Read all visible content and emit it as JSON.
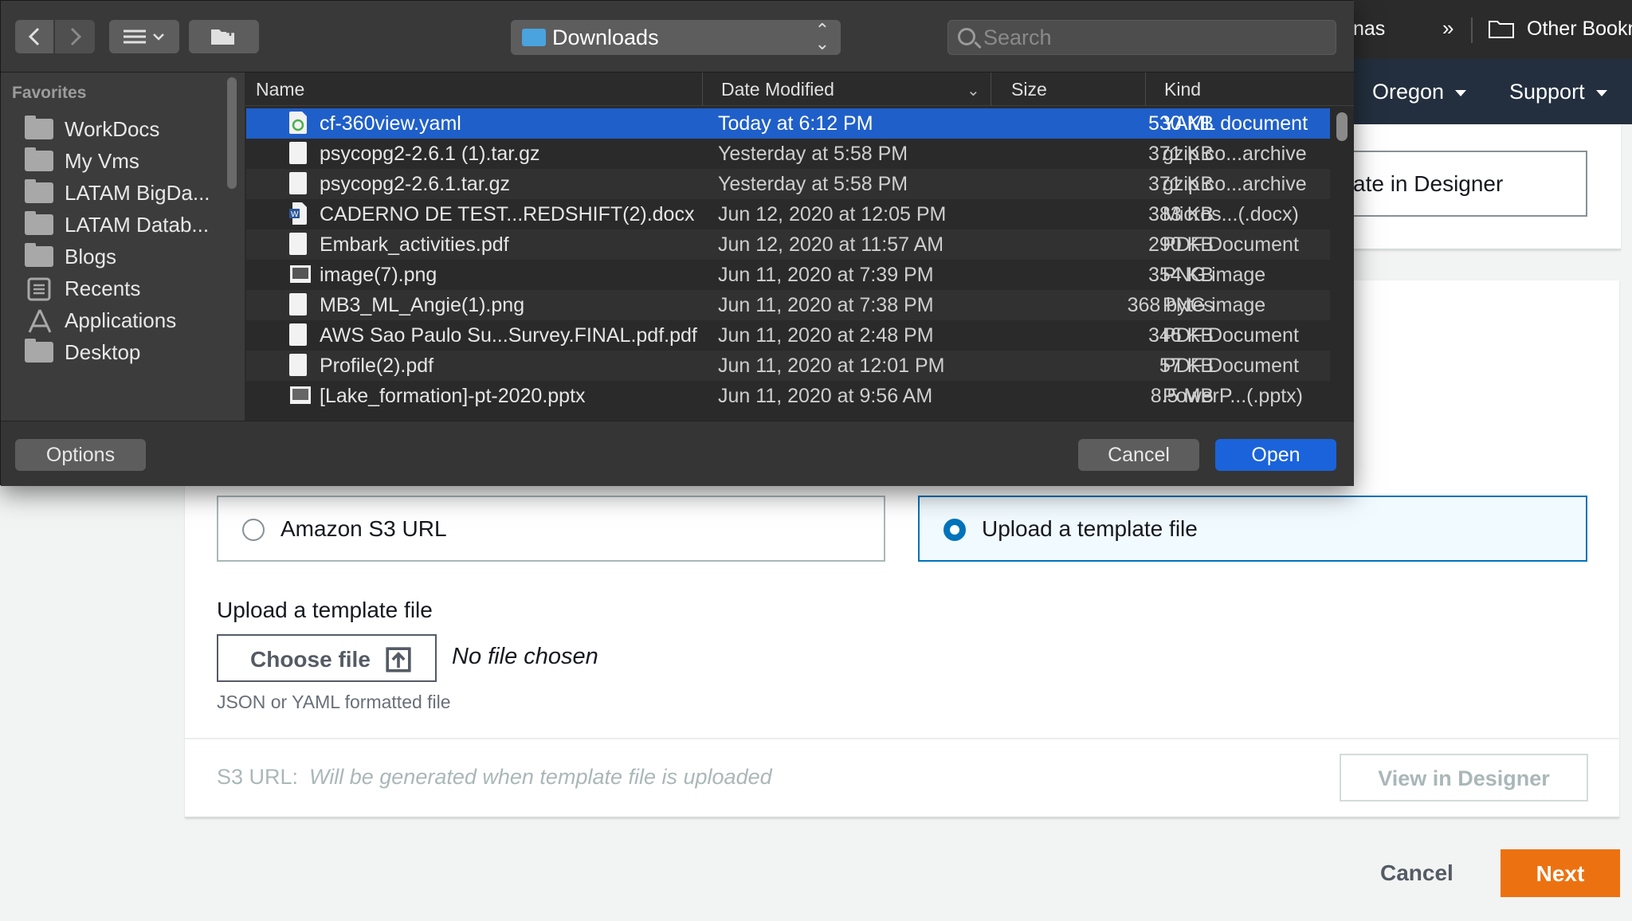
{
  "browser": {
    "bookmark_fragment": "nas",
    "bookmark_overflow": "»",
    "other_bookmarks": "Other Bookmarks"
  },
  "aws_nav": {
    "region": "Oregon",
    "support": "Support"
  },
  "top_card": {
    "designer_button_fragment": "ate in Designer"
  },
  "template_source": {
    "options": [
      {
        "label": "Amazon S3 URL",
        "selected": false
      },
      {
        "label": "Upload a template file",
        "selected": true
      }
    ],
    "upload_heading": "Upload a template file",
    "choose_file_label": "Choose file",
    "no_file_text": "No file chosen",
    "hint": "JSON or YAML formatted file",
    "s3_url_label": "S3 URL:",
    "s3_url_value": "Will be generated when template file is uploaded",
    "view_in_designer": "View in Designer"
  },
  "page_actions": {
    "cancel": "Cancel",
    "next": "Next"
  },
  "dialog": {
    "location": "Downloads",
    "search_placeholder": "Search",
    "sidebar": {
      "heading": "Favorites",
      "items": [
        {
          "label": "WorkDocs",
          "icon": "folder-icon"
        },
        {
          "label": "My Vms",
          "icon": "folder-icon"
        },
        {
          "label": "LATAM BigDa...",
          "icon": "folder-icon"
        },
        {
          "label": "LATAM Datab...",
          "icon": "folder-icon"
        },
        {
          "label": "Blogs",
          "icon": "folder-icon"
        },
        {
          "label": "Recents",
          "icon": "recents-icon"
        },
        {
          "label": "Applications",
          "icon": "applications-icon"
        },
        {
          "label": "Desktop",
          "icon": "folder-icon"
        }
      ]
    },
    "columns": {
      "name": "Name",
      "date_modified": "Date Modified",
      "size": "Size",
      "kind": "Kind"
    },
    "files": [
      {
        "name": "cf-360view.yaml",
        "date": "Today at 6:12 PM",
        "size": "530 KB",
        "kind": "YAML document",
        "selected": true
      },
      {
        "name": "psycopg2-2.6.1 (1).tar.gz",
        "date": "Yesterday at 5:58 PM",
        "size": "371 KB",
        "kind": "gzip co...archive"
      },
      {
        "name": "psycopg2-2.6.1.tar.gz",
        "date": "Yesterday at 5:58 PM",
        "size": "371 KB",
        "kind": "gzip co...archive"
      },
      {
        "name": "CADERNO DE TEST...REDSHIFT(2).docx",
        "date": "Jun 12, 2020 at 12:05 PM",
        "size": "383 KB",
        "kind": "Micros...(.docx)"
      },
      {
        "name": "Embark_activities.pdf",
        "date": "Jun 12, 2020 at 11:57 AM",
        "size": "290 KB",
        "kind": "PDF Document"
      },
      {
        "name": "image(7).png",
        "date": "Jun 11, 2020 at 7:39 PM",
        "size": "354 KB",
        "kind": "PNG image"
      },
      {
        "name": "MB3_ML_Angie(1).png",
        "date": "Jun 11, 2020 at 7:38 PM",
        "size": "368 bytes",
        "kind": "PNG image"
      },
      {
        "name": "AWS Sao Paulo Su...Survey.FINAL.pdf.pdf",
        "date": "Jun 11, 2020 at 2:48 PM",
        "size": "346 KB",
        "kind": "PDF Document"
      },
      {
        "name": "Profile(2).pdf",
        "date": "Jun 11, 2020 at 12:01 PM",
        "size": "57 KB",
        "kind": "PDF Document"
      },
      {
        "name": "[Lake_formation]-pt-2020.pptx",
        "date": "Jun 11, 2020 at 9:56 AM",
        "size": "8.5 MB",
        "kind": "PowerP...(.pptx)"
      }
    ],
    "options_label": "Options",
    "cancel_label": "Cancel",
    "open_label": "Open"
  },
  "colors": {
    "selection": "#1f5fc9",
    "open_button": "#1a63db",
    "aws_orange": "#ec7211",
    "aws_blue": "#0073bb",
    "aws_navy": "#232f3e"
  }
}
